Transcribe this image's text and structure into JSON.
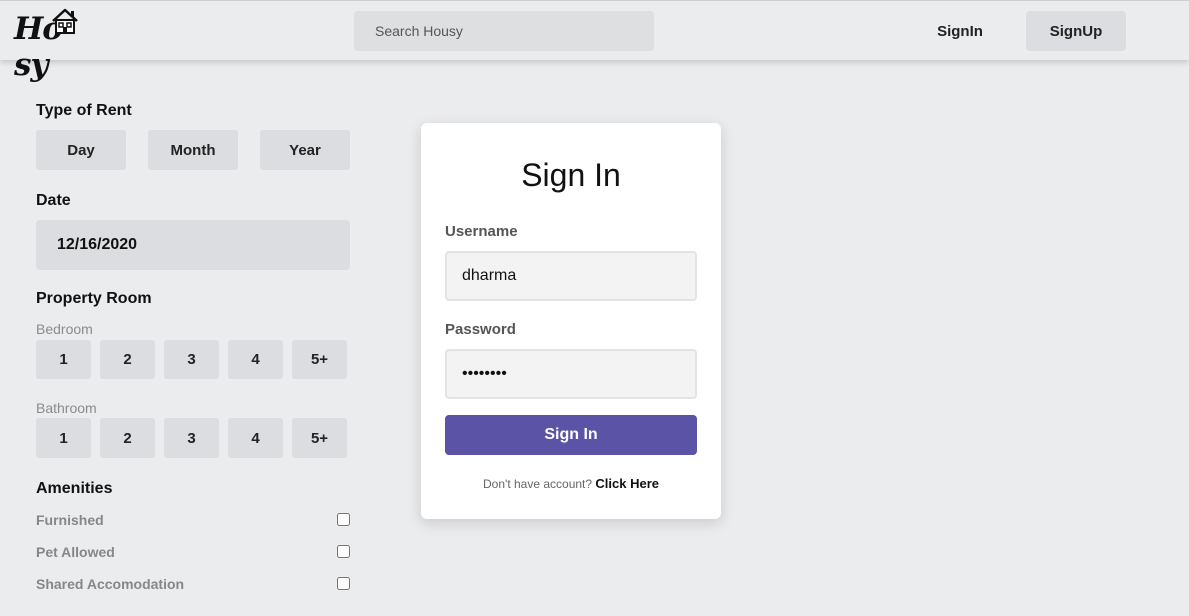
{
  "header": {
    "logo_text": "Ho   sy",
    "search_placeholder": "Search Housy",
    "signin_label": "SignIn",
    "signup_label": "SignUp"
  },
  "sidebar": {
    "rent_title": "Type of Rent",
    "rent_options": [
      "Day",
      "Month",
      "Year"
    ],
    "date_title": "Date",
    "date_value": "12/16/2020",
    "room_title": "Property Room",
    "bedroom_label": "Bedroom",
    "bedroom_options": [
      "1",
      "2",
      "3",
      "4",
      "5+"
    ],
    "bathroom_label": "Bathroom",
    "bathroom_options": [
      "1",
      "2",
      "3",
      "4",
      "5+"
    ],
    "amenities_title": "Amenities",
    "amenities": [
      "Furnished",
      "Pet Allowed",
      "Shared Accomodation"
    ]
  },
  "signin_card": {
    "title": "Sign In",
    "username_label": "Username",
    "username_value": "dharma",
    "password_label": "Password",
    "password_value": "dharma12",
    "submit_label": "Sign In",
    "footer_text": "Don't have account? ",
    "footer_link": "Click Here"
  },
  "colors": {
    "background": "#ebecee",
    "button": "#dcdde0",
    "primary": "#5b53a6"
  }
}
